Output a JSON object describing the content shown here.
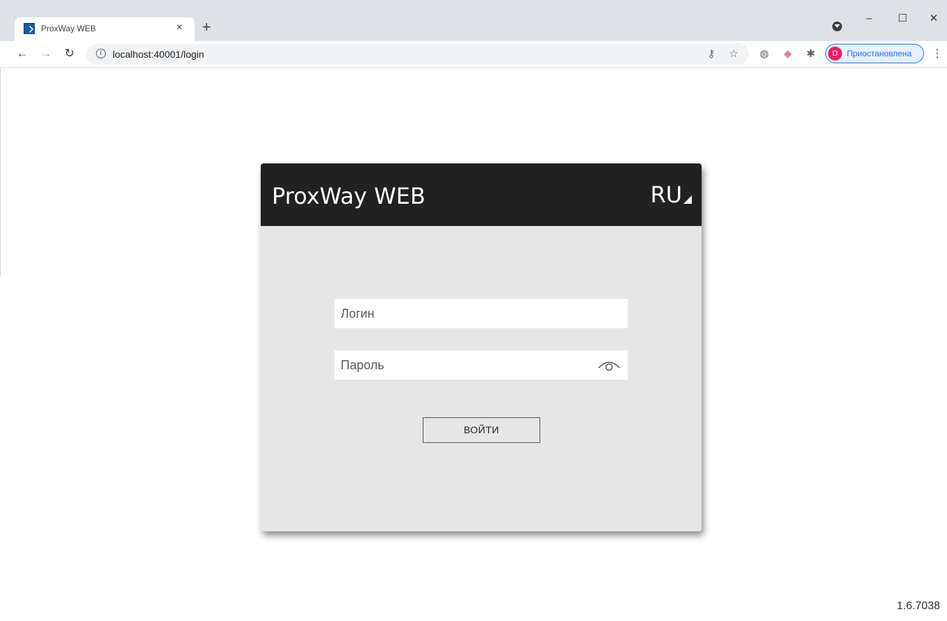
{
  "browser": {
    "tab_title": "ProxWay WEB",
    "tab_close": "×",
    "new_tab": "+",
    "url": "localhost:40001/login",
    "profile_initial": "D",
    "profile_status": "Приостановлена",
    "window_minimize": "–",
    "window_maximize": "☐",
    "window_close": "✕"
  },
  "login": {
    "app_title": "ProxWay WEB",
    "language": "RU",
    "username_placeholder": "Логин",
    "password_placeholder": "Пароль",
    "submit_label": "ВОЙТИ"
  },
  "footer": {
    "version": "1.6.7038"
  },
  "colors": {
    "header_bg": "#212121",
    "card_bg": "#e6e6e6",
    "accent": "#1a73e8"
  }
}
